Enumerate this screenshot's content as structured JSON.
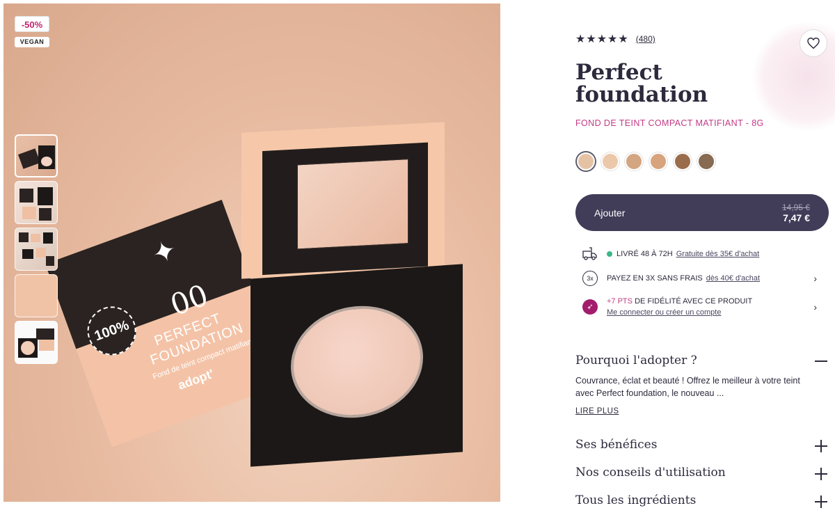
{
  "badges": {
    "discount": "-50%",
    "vegan": "VEGAN"
  },
  "rating": {
    "stars": "★★★★★",
    "count": "(480)"
  },
  "product": {
    "title": "Perfect foundation",
    "subtitle": "FOND DE TEINT COMPACT MATIFIANT - 8G"
  },
  "swatches": [
    "#e6c2a5",
    "#ecc8aa",
    "#d3a581",
    "#d7a47e",
    "#9b6c4c",
    "#876a52"
  ],
  "cart": {
    "label": "Ajouter",
    "old_price": "14,95 €",
    "new_price": "7,47 €"
  },
  "info": {
    "delivery_text": "LIVRÉ 48 À 72H",
    "delivery_link": "Gratuite dès 35€ d'achat",
    "installment_icon": "3x",
    "installment_text": "PAYEZ EN 3X SANS FRAIS",
    "installment_link": "dès 40€ d'achat",
    "loyalty_points": "+7 PTS",
    "loyalty_text": "DE FIDÉLITÉ AVEC CE PRODUIT",
    "loyalty_link": "Me connecter ou créer un compte"
  },
  "accordion": {
    "why_title": "Pourquoi l'adopter ?",
    "why_body": "Couvrance, éclat et beauté ! Offrez le meilleur à votre teint avec Perfect foundation, le nouveau ...",
    "read_more": "LIRE PLUS",
    "benefits_title": "Ses bénéfices",
    "usage_title": "Nos conseils d'utilisation",
    "ingredients_title": "Tous les ingrédients"
  },
  "package": {
    "seal": "100%",
    "shade": "00",
    "line1": "PERFECT",
    "line2": "FOUNDATION",
    "line3": "Fond de teint compact matifiant",
    "brand": "adopt'"
  },
  "icons": {
    "favorite": "heart-icon",
    "delivery": "truck-icon",
    "loyalty": "bird-icon",
    "chevron": "chevron-right-icon"
  }
}
